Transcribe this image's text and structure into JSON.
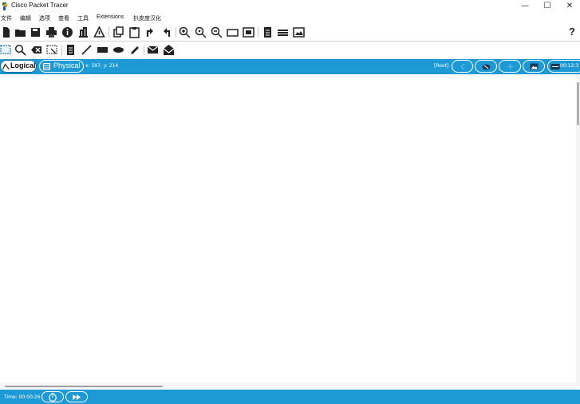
{
  "window": {
    "title": "Cisco Packet Tracer",
    "icons": {
      "app": "packet-tracer-logo-icon",
      "minimize": "minimize-icon",
      "maximize": "maximize-icon",
      "close": "close-icon"
    }
  },
  "menu": {
    "items": [
      {
        "label": "文件"
      },
      {
        "label": "编辑"
      },
      {
        "label": "选项"
      },
      {
        "label": "查看"
      },
      {
        "label": "工具"
      },
      {
        "label": "Extensions"
      },
      {
        "label": "扒皮度汉化"
      }
    ]
  },
  "toolbar": {
    "icons": [
      "new-file-icon",
      "open-folder-icon",
      "save-icon",
      "print-icon",
      "info-icon",
      "activity-wizard-icon",
      "network-info-icon",
      "copy-icon",
      "paste-icon",
      "undo-icon",
      "redo-icon",
      "zoom-in-icon",
      "zoom-reset-icon",
      "zoom-out-icon",
      "drawing-palette-icon",
      "custom-device-icon",
      "notes-icon",
      "viewport-icon",
      "screenshot-icon"
    ],
    "help_label": "?"
  },
  "toolbar2": {
    "icons": [
      "select-icon",
      "inspect-icon",
      "delete-icon",
      "resize-icon",
      "note-icon",
      "line-icon",
      "rectangle-icon",
      "ellipse-icon",
      "freeform-icon",
      "add-simple-pdu-icon",
      "add-complex-pdu-icon"
    ]
  },
  "workspace_bar": {
    "logical_label": "Logical",
    "physical_label": "Physical",
    "coords": "x: 597, y: 214",
    "root_label": "[Root]",
    "clock": "00:12:3"
  },
  "status": {
    "time_label": "Time: 00:00:26"
  },
  "colors": {
    "accent": "#1d9ad6",
    "background": "#ffffff"
  }
}
